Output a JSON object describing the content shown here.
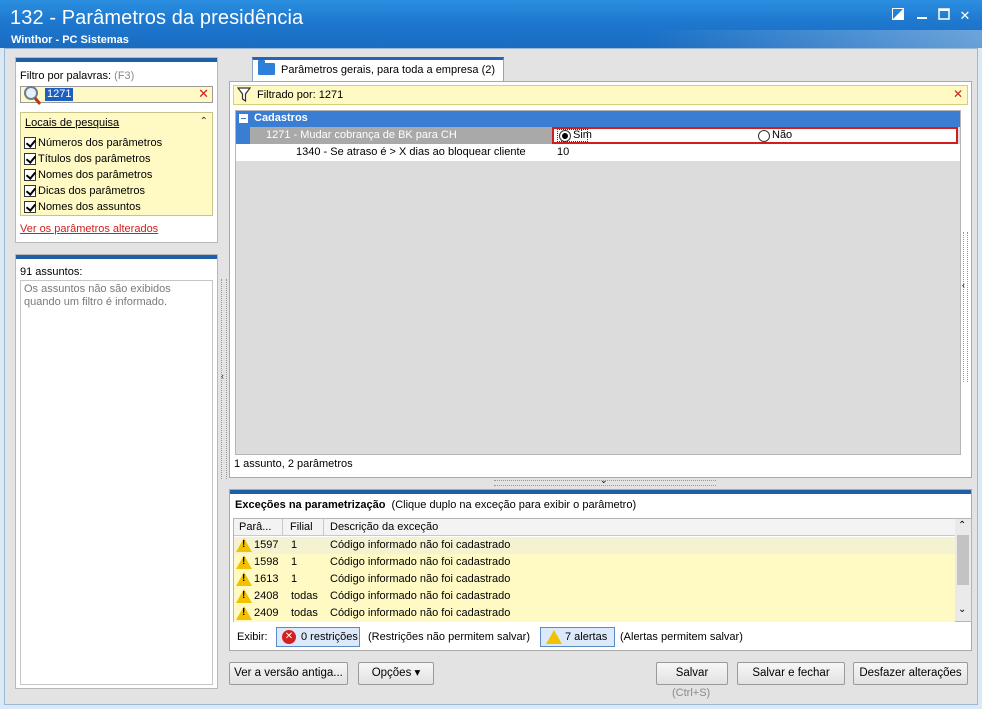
{
  "window": {
    "title": "132 - Parâmetros da presidência",
    "subtitle": "Winthor - PC Sistemas",
    "controls": {
      "close": "✕"
    }
  },
  "filter": {
    "label": "Filtro por palavras:",
    "shortcut": "(F3)",
    "value": "1271",
    "clear": "✕"
  },
  "search_locations": {
    "title": "Locais de pesquisa",
    "items": [
      "Números dos parâmetros",
      "Títulos dos parâmetros",
      "Nomes dos parâmetros",
      "Dicas dos parâmetros",
      "Nomes dos assuntos"
    ]
  },
  "altered_link": "Ver os parâmetros alterados",
  "subjects": {
    "count": "91 assuntos:",
    "message": "Os assuntos não são exibidos quando um filtro é informado."
  },
  "tab": {
    "label": "Parâmetros gerais, para toda a empresa",
    "count": "(2)"
  },
  "filtered_bar": {
    "text": "Filtrado por: 1271",
    "clear": "✕"
  },
  "grid": {
    "group": "Cadastros",
    "rows": [
      {
        "name": "1271 - Mudar cobrança de BK para CH",
        "opt_yes": "Sim",
        "opt_no": "Não"
      },
      {
        "name": "1340 - Se atraso é > X dias ao bloquear cliente",
        "value": "10"
      }
    ],
    "summary": "1 assunto, 2 parâmetros"
  },
  "exceptions": {
    "title": "Exceções na parametrização",
    "subtitle": "(Clique duplo na exceção para exibir o parâmetro)",
    "columns": [
      "Parâ...",
      "Filial",
      "Descrição da exceção"
    ],
    "rows": [
      {
        "param": "1597",
        "filial": "1",
        "desc": "Código informado não foi cadastrado"
      },
      {
        "param": "1598",
        "filial": "1",
        "desc": "Código informado não foi cadastrado"
      },
      {
        "param": "1613",
        "filial": "1",
        "desc": "Código informado não foi cadastrado"
      },
      {
        "param": "2408",
        "filial": "todas",
        "desc": "Código informado não foi cadastrado"
      },
      {
        "param": "2409",
        "filial": "todas",
        "desc": "Código informado não foi cadastrado"
      }
    ],
    "exibir": "Exibir:",
    "restrictions_btn": "0 restrições",
    "restrictions_note": "(Restrições não permitem salvar)",
    "alerts_btn": "7 alertas",
    "alerts_note": "(Alertas permitem salvar)"
  },
  "buttons": {
    "old_version": "Ver a versão antiga...",
    "options": "Opções",
    "save": "Salvar",
    "save_hint": "(Ctrl+S)",
    "save_close": "Salvar e fechar",
    "undo": "Desfazer alterações"
  },
  "colors": {
    "title_bar": "#1e78cf",
    "highlight_yellow": "#fff9c4",
    "group_blue": "#3a7ed3",
    "error_red": "#d11d1d"
  }
}
